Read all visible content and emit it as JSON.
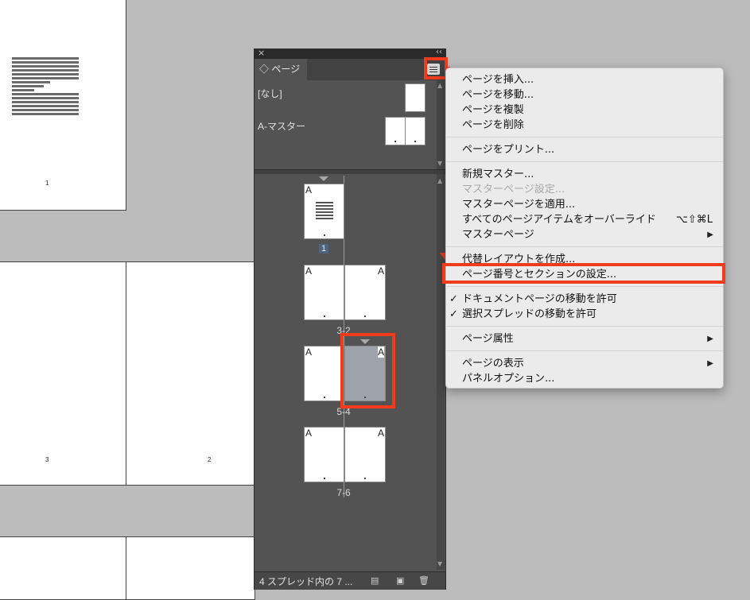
{
  "document": {
    "page_numbers": [
      "1",
      "3",
      "2"
    ]
  },
  "panel": {
    "close_glyph": "×",
    "collapse_glyph": "‹‹",
    "tab_label": "◇ ページ",
    "masters": [
      {
        "label": "[なし]"
      },
      {
        "label": "A-マスター"
      }
    ],
    "spreads": [
      {
        "label": "1",
        "pages": [
          "A"
        ]
      },
      {
        "label": "3-2",
        "pages": [
          "A",
          "A"
        ]
      },
      {
        "label": "5-4",
        "pages": [
          "A",
          "A"
        ]
      },
      {
        "label": "7-6",
        "pages": [
          "A",
          "A"
        ]
      }
    ],
    "footer_text": "4 スプレッド内の 7 ...",
    "footer_icons": [
      "page-size-icon",
      "new-page-icon",
      "trash-icon"
    ]
  },
  "menu": {
    "items": [
      {
        "label": "ページを挿入..."
      },
      {
        "label": "ページを移動..."
      },
      {
        "label": "ページを複製"
      },
      {
        "label": "ページを削除"
      },
      {
        "label": "ページをプリント..."
      },
      {
        "label": "新規マスター..."
      },
      {
        "label": "マスターページ設定...",
        "disabled": true
      },
      {
        "label": "マスターページを適用..."
      },
      {
        "label": "すべてのページアイテムをオーバーライド",
        "shortcut": "⌥⇧⌘L"
      },
      {
        "label": "マスターページ",
        "submenu": "▶"
      },
      {
        "label": "代替レイアウトを作成..."
      },
      {
        "label": "ページ番号とセクションの設定..."
      },
      {
        "label": "ドキュメントページの移動を許可",
        "check": "✓"
      },
      {
        "label": "選択スプレッドの移動を許可",
        "check": "✓"
      },
      {
        "label": "ページ属性",
        "submenu": "▶"
      },
      {
        "label": "ページの表示",
        "submenu": "▶"
      },
      {
        "label": "パネルオプション..."
      }
    ]
  },
  "colors": {
    "highlight": "#f23a1c",
    "panel_bg": "#535353",
    "menu_bg": "#ebebeb",
    "canvas_bg": "#bcbcbc"
  }
}
